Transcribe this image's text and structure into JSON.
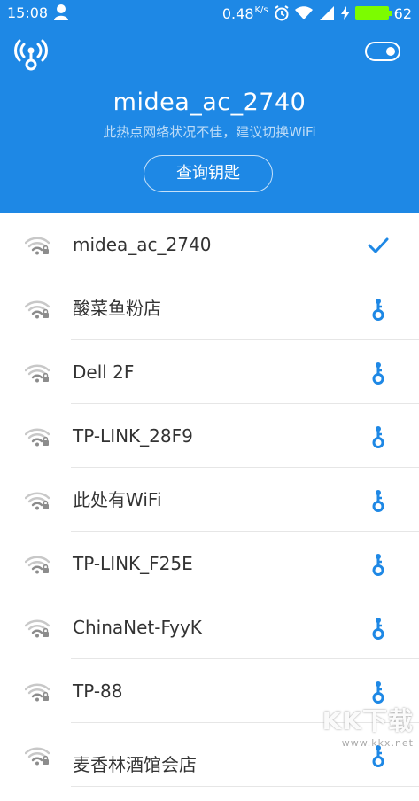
{
  "status_bar": {
    "time": "15:08",
    "speed": "0.48",
    "speed_unit": "K/s",
    "battery": "62"
  },
  "hero": {
    "ssid": "midea_ac_2740",
    "subtitle": "此热点网络状况不佳，建议切换WiFi",
    "button_label": "查询钥匙"
  },
  "networks": [
    {
      "name": "midea_ac_2740",
      "action": "check-icon"
    },
    {
      "name": "酸菜鱼粉店",
      "action": "key-icon"
    },
    {
      "name": "Dell 2F",
      "action": "key-icon"
    },
    {
      "name": "TP-LINK_28F9",
      "action": "key-icon"
    },
    {
      "name": "此处有WiFi",
      "action": "key-icon"
    },
    {
      "name": "TP-LINK_F25E",
      "action": "key-icon"
    },
    {
      "name": "ChinaNet-FyyK",
      "action": "key-icon"
    },
    {
      "name": "TP-88",
      "action": "key-icon"
    },
    {
      "name": "麦香林酒馆会店",
      "action": "key-icon"
    }
  ],
  "watermark": {
    "text": "KK下载",
    "url": "www.kkx.net"
  },
  "colors": {
    "header_bg": "#1E88E5",
    "accent": "#1E88E5"
  }
}
